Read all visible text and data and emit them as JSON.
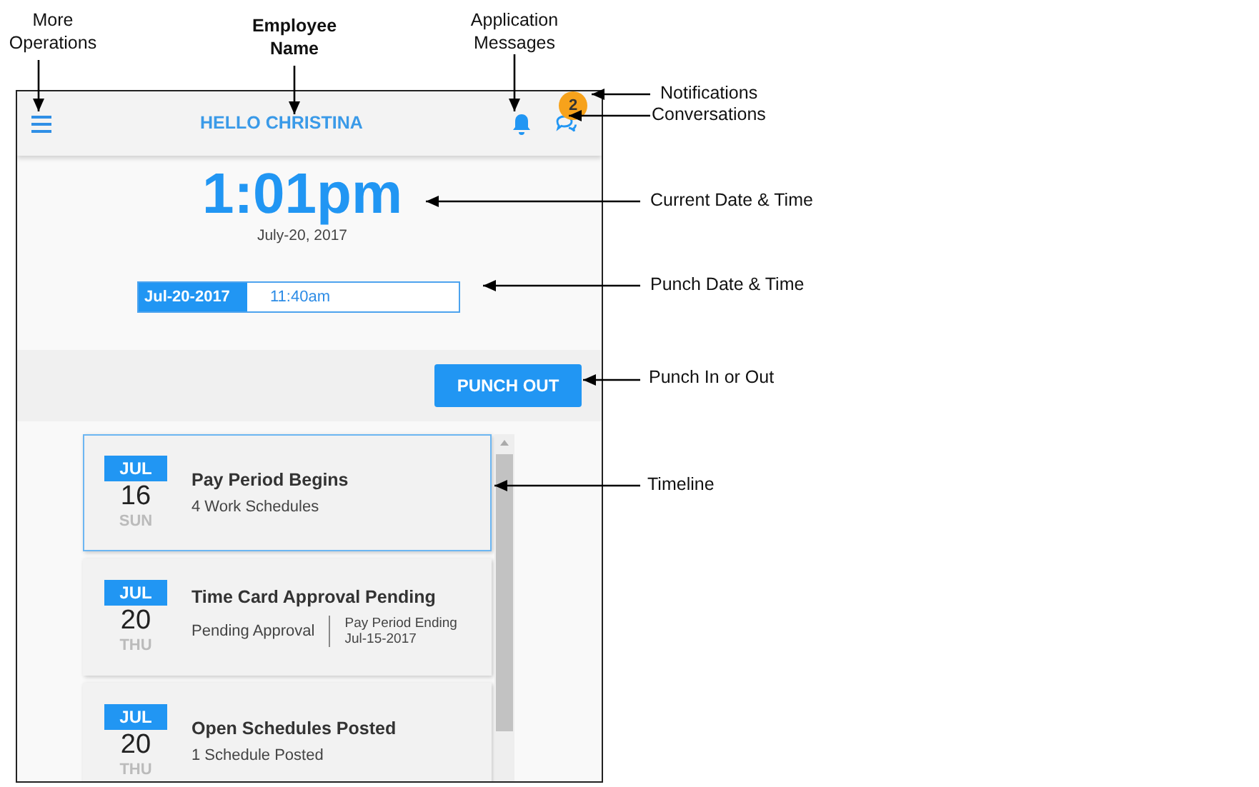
{
  "annotations": [
    {
      "label": "More Operations"
    },
    {
      "label": "Employee Name"
    },
    {
      "label": "Application Messages"
    },
    {
      "label": "Notifications"
    },
    {
      "label": "Conversations"
    },
    {
      "label": "Current Date & Time"
    },
    {
      "label": "Punch Date & Time"
    },
    {
      "label": "Punch In or Out"
    },
    {
      "label": "Timeline"
    }
  ],
  "app": {
    "greeting": "HELLO CHRISTINA",
    "badge": "2",
    "clock": {
      "time": "1:01pm",
      "date": "July-20, 2017"
    },
    "punch": {
      "date": "Jul-20-2017",
      "time": "11:40am"
    },
    "punch_button": "PUNCH OUT",
    "timeline": [
      {
        "month": "JUL",
        "day": "16",
        "weekday": "SUN",
        "title": "Pay Period Begins",
        "subtitle": "4 Work Schedules",
        "selected": true
      },
      {
        "month": "JUL",
        "day": "20",
        "weekday": "THU",
        "title": "Time Card Approval Pending",
        "subtitle": "Pending Approval",
        "note": [
          "Pay Period Ending",
          "Jul-15-2017"
        ],
        "selected": false
      },
      {
        "month": "JUL",
        "day": "20",
        "weekday": "THU",
        "title": "Open Schedules Posted",
        "subtitle": "1 Schedule Posted",
        "selected": false
      }
    ]
  }
}
